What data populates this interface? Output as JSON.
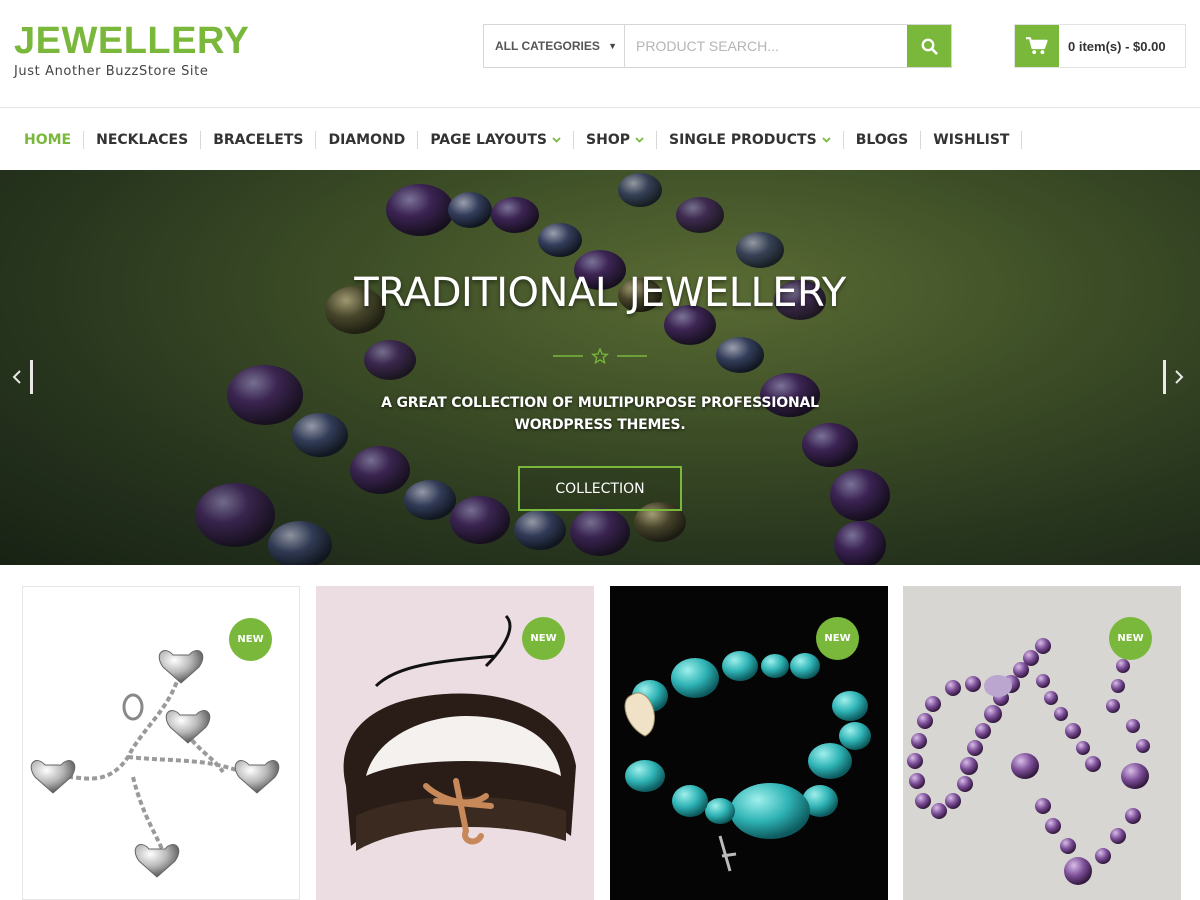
{
  "site": {
    "title": "JEWELLERY",
    "tagline": "Just Another BuzzStore Site"
  },
  "search": {
    "category": "ALL CATEGORIES",
    "placeholder": "PRODUCT SEARCH..."
  },
  "cart": {
    "summary": "0 item(s) - $0.00"
  },
  "nav": {
    "items": [
      {
        "label": "HOME",
        "active": true,
        "dropdown": false
      },
      {
        "label": "NECKLACES",
        "active": false,
        "dropdown": false
      },
      {
        "label": "BRACELETS",
        "active": false,
        "dropdown": false
      },
      {
        "label": "DIAMOND",
        "active": false,
        "dropdown": false
      },
      {
        "label": "PAGE LAYOUTS",
        "active": false,
        "dropdown": true
      },
      {
        "label": "SHOP",
        "active": false,
        "dropdown": true
      },
      {
        "label": "SINGLE PRODUCTS",
        "active": false,
        "dropdown": true
      },
      {
        "label": "BLOGS",
        "active": false,
        "dropdown": false
      },
      {
        "label": "WISHLIST",
        "active": false,
        "dropdown": false
      }
    ]
  },
  "hero": {
    "title": "TRADITIONAL JEWELLERY",
    "subtitle_line1": "A GREAT COLLECTION OF MULTIPURPOSE PROFESSIONAL",
    "subtitle_line2": "WORDPRESS THEMES.",
    "button": "COLLECTION"
  },
  "products": [
    {
      "badge": "NEW",
      "icon": "heart-charm-bracelet-image"
    },
    {
      "badge": "NEW",
      "icon": "leather-anchor-bracelet-image"
    },
    {
      "badge": "NEW",
      "icon": "turquoise-bracelet-image"
    },
    {
      "badge": "NEW",
      "icon": "amethyst-bead-necklace-image"
    }
  ],
  "colors": {
    "accent": "#7ab83c",
    "text": "#333333"
  }
}
